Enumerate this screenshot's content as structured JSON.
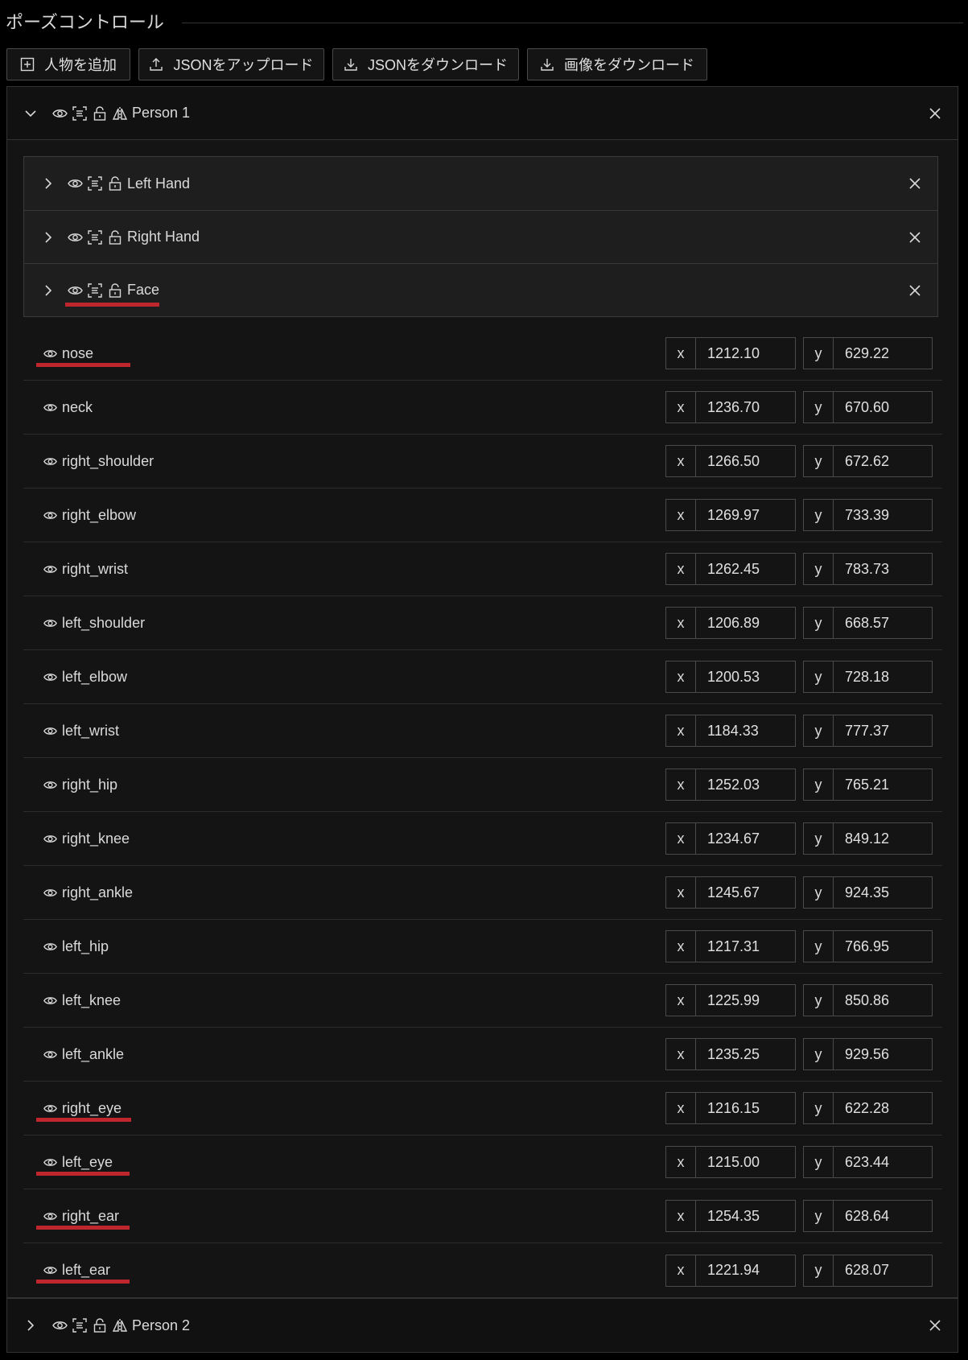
{
  "panel": {
    "title": "ポーズコントロール"
  },
  "toolbar": {
    "add_person_label": "人物を追加",
    "upload_json_label": "JSONをアップロード",
    "download_json_label": "JSONをダウンロード",
    "download_image_label": "画像をダウンロード"
  },
  "persons": [
    {
      "name": "Person 1",
      "expanded": true,
      "parts": [
        {
          "name": "Left Hand"
        },
        {
          "name": "Right Hand"
        },
        {
          "name": "Face"
        }
      ],
      "keypoints": [
        {
          "name": "nose",
          "x": "1212.10",
          "y": "629.22"
        },
        {
          "name": "neck",
          "x": "1236.70",
          "y": "670.60"
        },
        {
          "name": "right_shoulder",
          "x": "1266.50",
          "y": "672.62"
        },
        {
          "name": "right_elbow",
          "x": "1269.97",
          "y": "733.39"
        },
        {
          "name": "right_wrist",
          "x": "1262.45",
          "y": "783.73"
        },
        {
          "name": "left_shoulder",
          "x": "1206.89",
          "y": "668.57"
        },
        {
          "name": "left_elbow",
          "x": "1200.53",
          "y": "728.18"
        },
        {
          "name": "left_wrist",
          "x": "1184.33",
          "y": "777.37"
        },
        {
          "name": "right_hip",
          "x": "1252.03",
          "y": "765.21"
        },
        {
          "name": "right_knee",
          "x": "1234.67",
          "y": "849.12"
        },
        {
          "name": "right_ankle",
          "x": "1245.67",
          "y": "924.35"
        },
        {
          "name": "left_hip",
          "x": "1217.31",
          "y": "766.95"
        },
        {
          "name": "left_knee",
          "x": "1225.99",
          "y": "850.86"
        },
        {
          "name": "left_ankle",
          "x": "1235.25",
          "y": "929.56"
        },
        {
          "name": "right_eye",
          "x": "1216.15",
          "y": "622.28"
        },
        {
          "name": "left_eye",
          "x": "1215.00",
          "y": "623.44"
        },
        {
          "name": "right_ear",
          "x": "1254.35",
          "y": "628.64"
        },
        {
          "name": "left_ear",
          "x": "1221.94",
          "y": "628.07"
        }
      ]
    },
    {
      "name": "Person 2",
      "expanded": false
    }
  ],
  "axis_labels": {
    "x": "x",
    "y": "y"
  },
  "icons": [
    "plus-square-icon",
    "upload-icon",
    "download-icon",
    "eye-icon",
    "bounding-box-icon",
    "unlock-icon",
    "flip-horizontal-icon",
    "chevron-down-icon",
    "chevron-right-icon",
    "close-icon"
  ],
  "colors": {
    "background": "#000000",
    "panel": "#141414",
    "subpanel": "#1e1e1e",
    "text": "#d8d8d8",
    "annotation_underline": "#c0262d"
  }
}
